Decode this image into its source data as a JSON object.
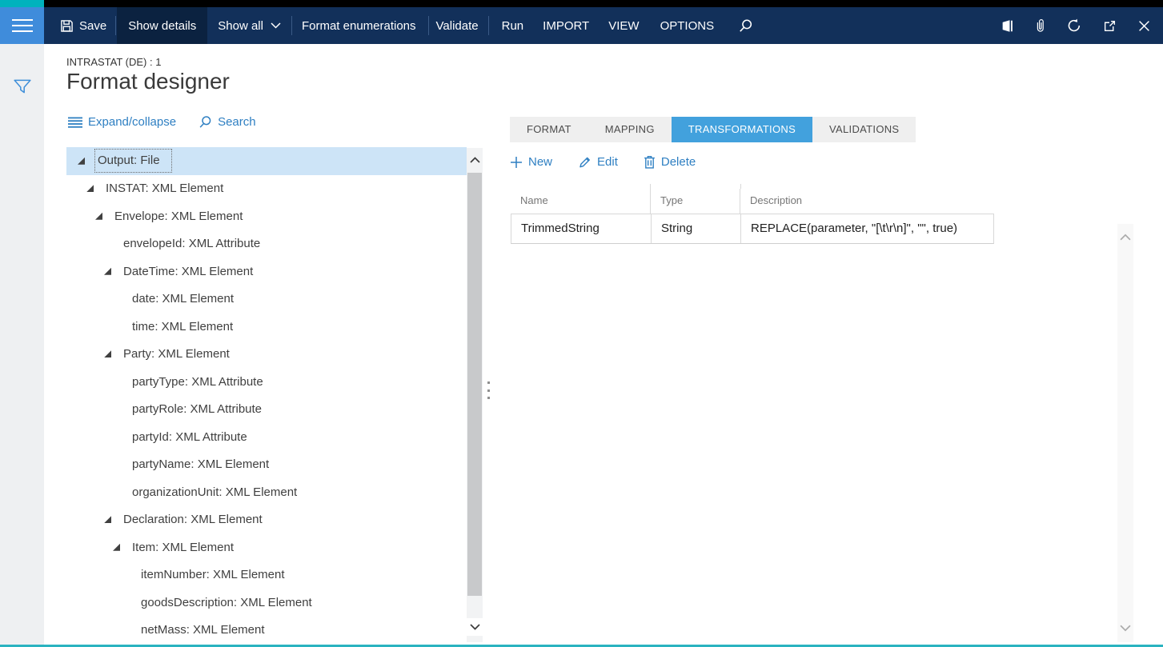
{
  "topbar": {
    "save": "Save",
    "show_details": "Show details",
    "show_all": "Show all",
    "format_enumerations": "Format enumerations",
    "validate": "Validate",
    "run": "Run",
    "import": "IMPORT",
    "view": "VIEW",
    "options": "OPTIONS"
  },
  "page": {
    "caption": "INTRASTAT (DE) : 1",
    "title": "Format designer"
  },
  "tree_toolbar": {
    "expand_collapse": "Expand/collapse",
    "search": "Search"
  },
  "tree": {
    "items": [
      {
        "label": "Output: File",
        "level": 0,
        "has_children": true,
        "selected": true
      },
      {
        "label": "INSTAT: XML Element",
        "level": 1,
        "has_children": true,
        "selected": false
      },
      {
        "label": "Envelope: XML Element",
        "level": 2,
        "has_children": true,
        "selected": false
      },
      {
        "label": "envelopeId: XML Attribute",
        "level": 3,
        "has_children": false,
        "selected": false
      },
      {
        "label": "DateTime: XML Element",
        "level": 3,
        "has_children": true,
        "selected": false
      },
      {
        "label": "date: XML Element",
        "level": 4,
        "has_children": false,
        "selected": false
      },
      {
        "label": "time: XML Element",
        "level": 4,
        "has_children": false,
        "selected": false
      },
      {
        "label": "Party: XML Element",
        "level": 3,
        "has_children": true,
        "selected": false
      },
      {
        "label": "partyType: XML Attribute",
        "level": 4,
        "has_children": false,
        "selected": false
      },
      {
        "label": "partyRole: XML Attribute",
        "level": 4,
        "has_children": false,
        "selected": false
      },
      {
        "label": "partyId: XML Attribute",
        "level": 4,
        "has_children": false,
        "selected": false
      },
      {
        "label": "partyName: XML Element",
        "level": 4,
        "has_children": false,
        "selected": false
      },
      {
        "label": "organizationUnit: XML Element",
        "level": 4,
        "has_children": false,
        "selected": false
      },
      {
        "label": "Declaration: XML Element",
        "level": 3,
        "has_children": true,
        "selected": false
      },
      {
        "label": "Item: XML Element",
        "level": 4,
        "has_children": true,
        "selected": false
      },
      {
        "label": "itemNumber: XML Element",
        "level": 5,
        "has_children": false,
        "selected": false
      },
      {
        "label": "goodsDescription: XML Element",
        "level": 5,
        "has_children": false,
        "selected": false
      },
      {
        "label": "netMass: XML Element",
        "level": 5,
        "has_children": false,
        "selected": false
      }
    ]
  },
  "panel": {
    "tabs": [
      {
        "label": "FORMAT",
        "active": false
      },
      {
        "label": "MAPPING",
        "active": false
      },
      {
        "label": "TRANSFORMATIONS",
        "active": true
      },
      {
        "label": "VALIDATIONS",
        "active": false
      }
    ],
    "actions": {
      "new": "New",
      "edit": "Edit",
      "delete": "Delete"
    }
  },
  "table": {
    "columns": [
      "Name",
      "Type",
      "Description"
    ],
    "rows": [
      {
        "name": "TrimmedString",
        "type": "String",
        "description": "REPLACE(parameter, \"[\\t\\r\\n]\", \"\", true)"
      }
    ]
  },
  "colors": {
    "teal_accent": "#00b2bd",
    "topbar_bg": "#12305a",
    "hamburger_bg": "#3f8cdb",
    "tree_selection": "#cde4f7",
    "link_blue": "#2e7fc2",
    "active_tab_blue": "#42a1dd"
  }
}
